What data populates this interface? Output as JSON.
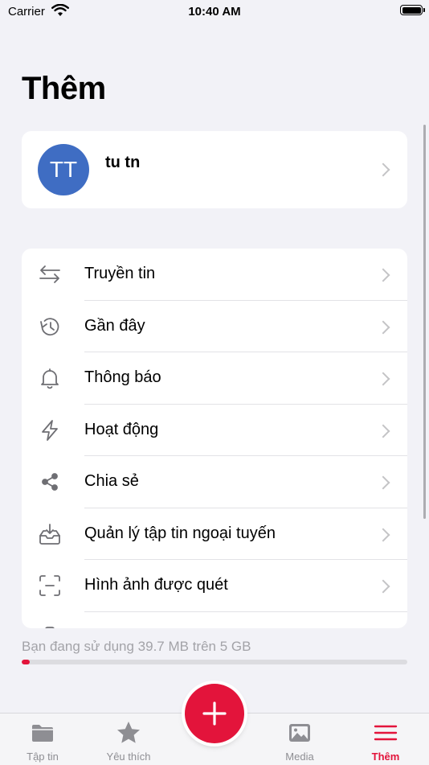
{
  "status_bar": {
    "carrier": "Carrier",
    "time": "10:40 AM"
  },
  "page_title": "Thêm",
  "profile": {
    "initials": "TT",
    "name": "tu tn",
    "avatar_color": "#3f6dc3"
  },
  "menu": {
    "items": [
      {
        "label": "Truyền tin",
        "icon": "transfer-arrows-icon"
      },
      {
        "label": "Gần đây",
        "icon": "history-clock-icon"
      },
      {
        "label": "Thông báo",
        "icon": "bell-icon"
      },
      {
        "label": "Hoạt động",
        "icon": "lightning-icon"
      },
      {
        "label": "Chia sẻ",
        "icon": "share-icon"
      },
      {
        "label": "Quản lý tập tin ngoại tuyến",
        "icon": "offline-download-icon"
      },
      {
        "label": "Hình ảnh được quét",
        "icon": "scan-frame-icon"
      }
    ]
  },
  "storage": {
    "text": "Bạn đang sử dụng 39.7 MB trên 5 GB",
    "used_fraction": 0.02
  },
  "tabbar": {
    "tabs": [
      {
        "label": "Tập tin",
        "icon": "folder-icon"
      },
      {
        "label": "Yêu thích",
        "icon": "star-icon"
      },
      {
        "label": "Media",
        "icon": "image-icon"
      },
      {
        "label": "Thêm",
        "icon": "menu-icon",
        "active": true
      }
    ],
    "fab_icon": "plus-icon"
  },
  "colors": {
    "accent": "#e3143b",
    "background": "#f2f2f7",
    "secondary_text": "#8e8e93"
  }
}
